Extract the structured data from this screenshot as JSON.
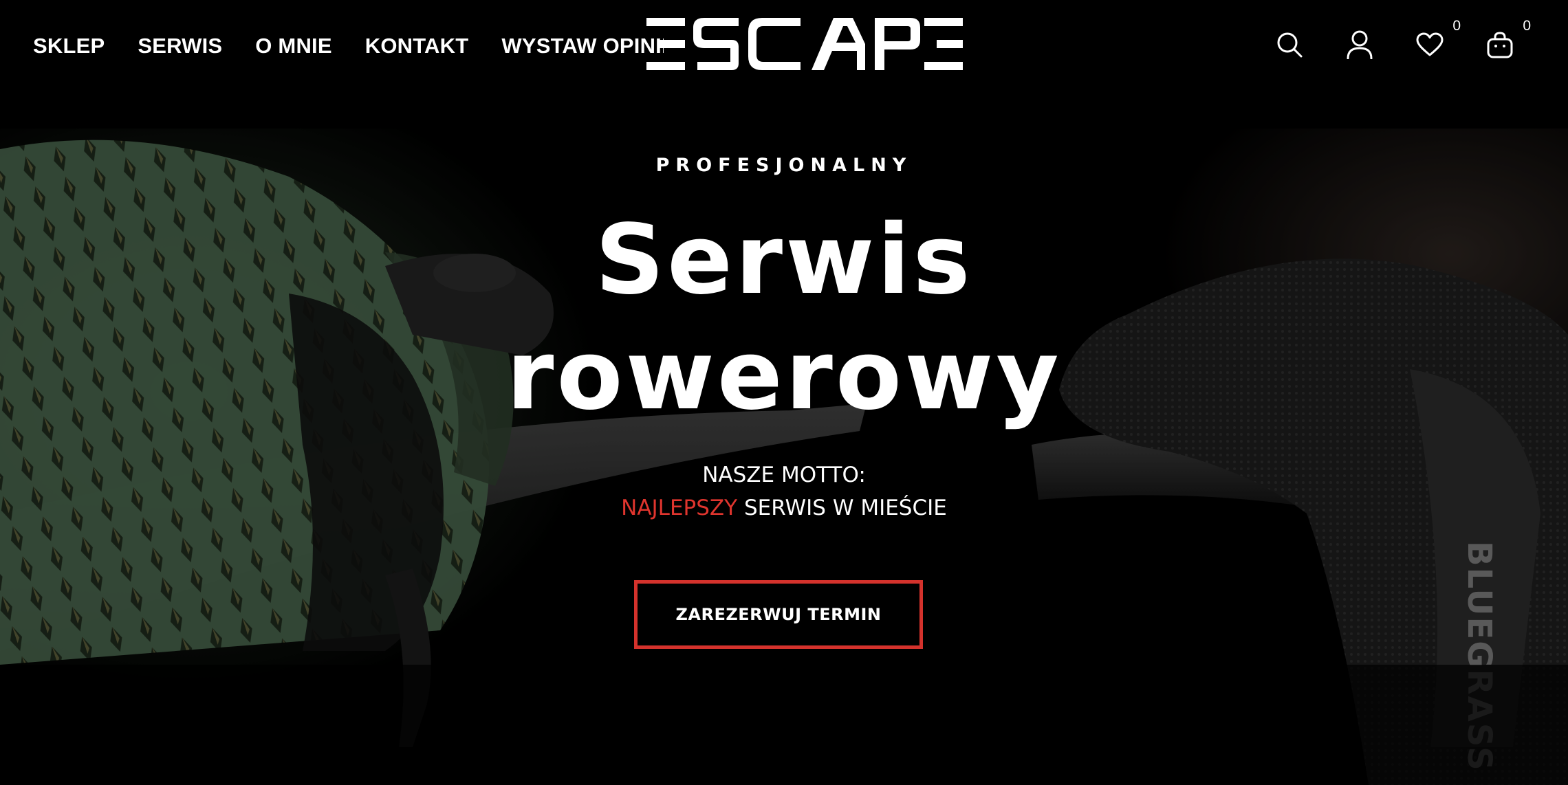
{
  "nav": {
    "items": [
      "SKLEP",
      "SERWIS",
      "O MNIE",
      "KONTAKT",
      "WYSTAW OPINIĘ"
    ]
  },
  "logo": {
    "text": "ESCAPE"
  },
  "header_icons": {
    "search": "search-icon",
    "account": "user-icon",
    "wishlist": {
      "icon": "heart-icon",
      "count": "0"
    },
    "cart": {
      "icon": "bag-icon",
      "count": "0"
    }
  },
  "hero": {
    "eyebrow": "PROFESJONALNY",
    "title_line1": "Serwis",
    "title_line2": "rowerowy",
    "motto_line1": "NASZE MOTTO:",
    "motto_accent": "NAJLEPSZY",
    "motto_rest": " SERWIS W MIEŚCIE",
    "cta_label": "ZAREZERWUJ TERMIN",
    "glove_brand": "BLUEGRASS"
  },
  "colors": {
    "background": "#000000",
    "text": "#ffffff",
    "accent_red": "#e0352e",
    "cta_border": "#d4322c"
  }
}
